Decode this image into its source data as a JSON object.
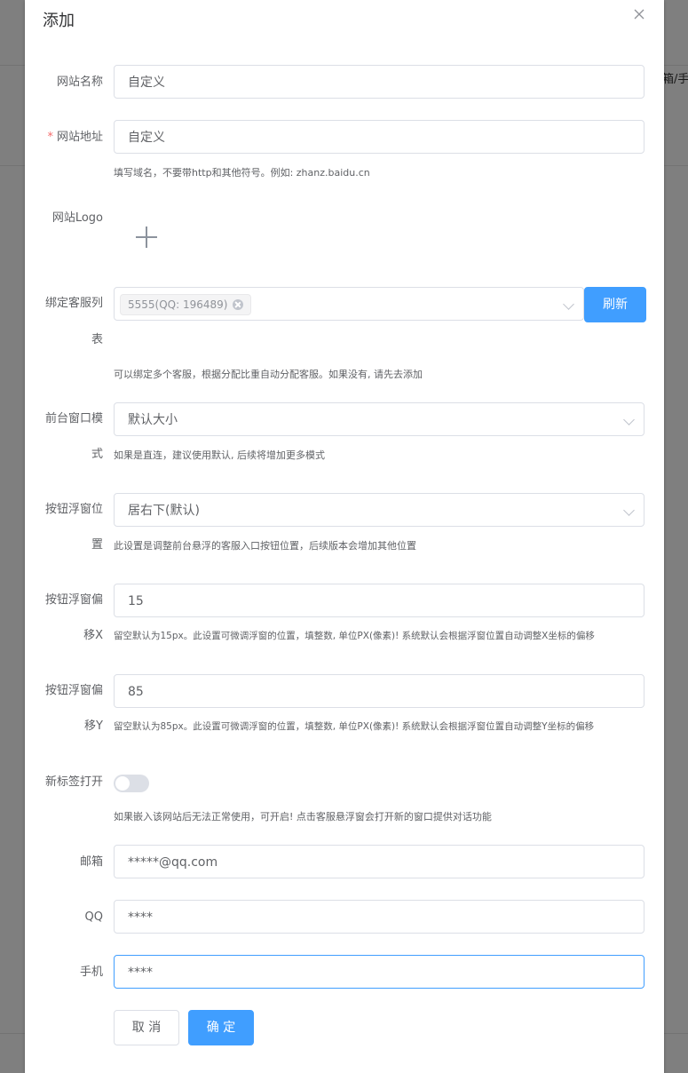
{
  "background": {
    "edge_text": "箱/手机"
  },
  "dialog": {
    "title": "添加",
    "close_icon": "close-icon"
  },
  "form": {
    "site_name": {
      "label": "网站名称",
      "value": "自定义"
    },
    "site_url": {
      "required_mark": "*",
      "label": "网站地址",
      "value": "自定义",
      "hint": "填写域名，不要带http和其他符号。例如: zhanz.baidu.cn"
    },
    "site_logo": {
      "label": "网站Logo",
      "upload_icon": "plus-icon"
    },
    "bind_service": {
      "label_line1": "绑定客服列",
      "label_line2": "表",
      "tag": "5555(QQ: 196489)",
      "refresh_label": "刷新",
      "hint": "可以绑定多个客服，根据分配比重自动分配客服。如果没有, 请先去添加"
    },
    "window_mode": {
      "label_line1": "前台窗口模",
      "label_line2": "式",
      "value": "默认大小",
      "hint": "如果是直连，建议使用默认, 后续将增加更多模式"
    },
    "float_position": {
      "label_line1": "按钮浮窗位",
      "label_line2": "置",
      "value": "居右下(默认)",
      "hint": "此设置是调整前台悬浮的客服入口按钮位置，后续版本会增加其他位置"
    },
    "offset_x": {
      "label_line1": "按钮浮窗偏",
      "label_line2": "移X",
      "value": "15",
      "hint": "留空默认为15px。此设置可微调浮窗的位置，填整数, 单位PX(像素)! 系统默认会根据浮窗位置自动调整X坐标的偏移"
    },
    "offset_y": {
      "label_line1": "按钮浮窗偏",
      "label_line2": "移Y",
      "value": "85",
      "hint": "留空默认为85px。此设置可微调浮窗的位置，填整数, 单位PX(像素)! 系统默认会根据浮窗位置自动调整Y坐标的偏移"
    },
    "new_tab": {
      "label": "新标签打开",
      "enabled": false,
      "hint": "如果嵌入该网站后无法正常使用，可开启! 点击客服悬浮窗会打开新的窗口提供对话功能"
    },
    "email": {
      "label": "邮箱",
      "value": "*****@qq.com"
    },
    "qq": {
      "label": "QQ",
      "value": "****"
    },
    "phone": {
      "label": "手机",
      "value": "****"
    }
  },
  "actions": {
    "cancel_label": "取 消",
    "confirm_label": "确 定"
  },
  "colors": {
    "primary": "#409eff",
    "required": "#f56c6c",
    "border": "#dcdfe6",
    "overlay": "#7f7f7f"
  }
}
